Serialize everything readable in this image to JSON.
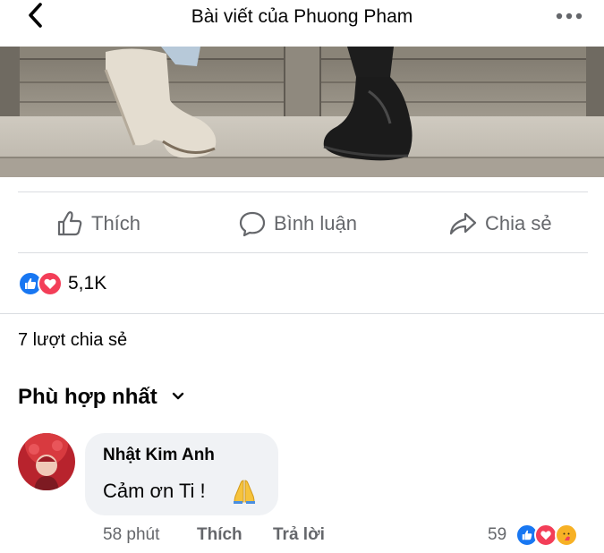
{
  "header": {
    "title": "Bài viết của Phuong Pham",
    "back_icon": "chevron-left-icon",
    "more_icon": "more-horizontal-icon"
  },
  "actions": {
    "like_label": "Thích",
    "comment_label": "Bình luận",
    "share_label": "Chia sẻ"
  },
  "reactions": {
    "count": "5,1K",
    "types": [
      "like",
      "love"
    ]
  },
  "shares": {
    "label": "7 lượt chia sẻ"
  },
  "comments": {
    "sort_label": "Phù hợp nhất",
    "items": [
      {
        "author": "Nhật Kim Anh",
        "text": "Cảm ơn Ti !",
        "emoji": "folded-hands",
        "time": "58 phút",
        "like_action": "Thích",
        "reply_action": "Trả lời",
        "reaction_count": "59",
        "reaction_types": [
          "like",
          "love",
          "care"
        ]
      }
    ]
  },
  "colors": {
    "like_blue": "#1877f2",
    "love_red": "#f33e58",
    "care_yellow": "#f7b125",
    "secondary_text": "#65676b",
    "bubble_bg": "#f0f2f5"
  }
}
